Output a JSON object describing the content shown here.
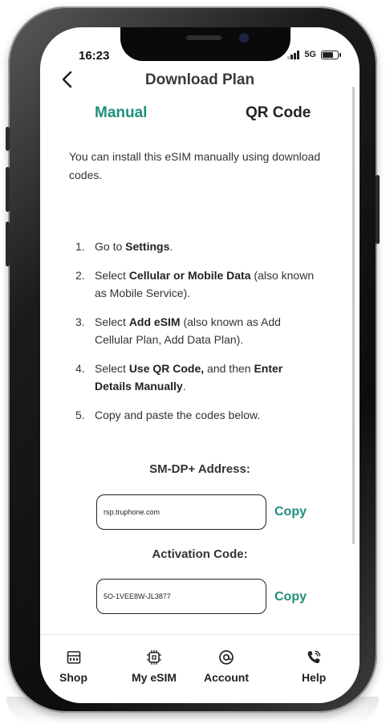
{
  "status_bar": {
    "time": "16:23",
    "network": "5G"
  },
  "nav": {
    "title": "Download Plan"
  },
  "tabs": [
    {
      "label": "Manual",
      "active": true
    },
    {
      "label": "QR Code",
      "active": false
    }
  ],
  "intro": "You can install this eSIM manually using download codes.",
  "steps": {
    "s1": {
      "num": "1.",
      "pre": "Go to ",
      "b1": "Settings",
      "post": "."
    },
    "s2": {
      "num": "2.",
      "pre": "Select ",
      "b1": "Cellular or Mobile Data",
      "post": " (also known as Mobile Service)."
    },
    "s3": {
      "num": "3.",
      "pre": "Select ",
      "b1": "Add eSIM",
      "post": " (also known as Add Cellular Plan, Add Data Plan)."
    },
    "s4": {
      "num": "4.",
      "pre": "Select ",
      "b1": "Use QR Code,",
      "mid": " and then ",
      "b2": "Enter Details Manually",
      "post": "."
    },
    "s5": {
      "num": "5.",
      "pre": "Copy and paste the codes below."
    }
  },
  "smdp": {
    "label": "SM-DP+ Address:",
    "value": "rsp.truphone.com",
    "copy_label": "Copy"
  },
  "activation": {
    "label": "Activation Code:",
    "value": "5O-1VEE8W-JL3877",
    "copy_label": "Copy"
  },
  "tabbar": {
    "items": [
      {
        "label": "Shop",
        "icon": "store-icon"
      },
      {
        "label": "My eSIM",
        "icon": "sim-chip-icon"
      },
      {
        "label": "Account",
        "icon": "at-sign-icon"
      },
      {
        "label": "Help",
        "icon": "phone-call-icon"
      }
    ]
  },
  "colors": {
    "accent": "#1e8f78",
    "text": "#333333",
    "frame": "#111111"
  }
}
